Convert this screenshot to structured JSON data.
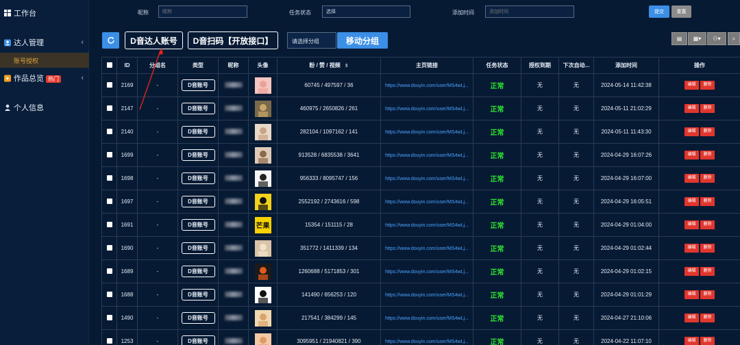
{
  "sidebar": {
    "workbench": "工作台",
    "talent_mgmt": "达人管理",
    "talent_sub": "账号授权",
    "works": "作品总览",
    "works_badge": "热门",
    "profile": "个人信息"
  },
  "filters": {
    "nickname_label": "昵称",
    "nickname_placeholder": "昵称",
    "status_label": "任务状态",
    "status_value": "选择",
    "time_label": "添加时间",
    "time_placeholder": "添加时间",
    "submit": "提交",
    "reset": "重置"
  },
  "toolbar": {
    "douyin_account": "D音达人账号",
    "douyin_scan": "D音扫码【开放接口】",
    "group_placeholder": "请选择分组",
    "move_group": "移动分组"
  },
  "table": {
    "headers": [
      "ID",
      "分组名",
      "类型",
      "昵称",
      "头像",
      "粉 / 赞 / 视频",
      "主页链接",
      "任务状态",
      "授权到期",
      "下次自动...",
      "添加时间",
      "操作"
    ],
    "edit_label": "编辑",
    "delete_label": "删除",
    "rows": [
      {
        "id": "2169",
        "group": "-",
        "type": "D音账号",
        "stats": "60745 / 497597 / 36",
        "link": "https://www.douyin.com/user/MS4wLj...",
        "status": "正常",
        "auth": "无",
        "next": "无",
        "time": "2024-05-14 11:42:38"
      },
      {
        "id": "2147",
        "group": "-",
        "type": "D音账号",
        "stats": "460975 / 2650826 / 261",
        "link": "https://www.douyin.com/user/MS4wLj...",
        "status": "正常",
        "auth": "无",
        "next": "无",
        "time": "2024-05-11 21:02:29"
      },
      {
        "id": "2140",
        "group": "-",
        "type": "D音账号",
        "stats": "282104 / 1097162 / 141",
        "link": "https://www.douyin.com/user/MS4wLj...",
        "status": "正常",
        "auth": "无",
        "next": "无",
        "time": "2024-05-11 11:43:30"
      },
      {
        "id": "1699",
        "group": "-",
        "type": "D音账号",
        "stats": "913528 / 6835538 / 3641",
        "link": "https://www.douyin.com/user/MS4wLj...",
        "status": "正常",
        "auth": "无",
        "next": "无",
        "time": "2024-04-29 16:07:26"
      },
      {
        "id": "1698",
        "group": "-",
        "type": "D音账号",
        "stats": "956333 / 8095747 / 156",
        "link": "https://www.douyin.com/user/MS4wLj...",
        "status": "正常",
        "auth": "无",
        "next": "无",
        "time": "2024-04-29 16:07:00"
      },
      {
        "id": "1697",
        "group": "-",
        "type": "D音账号",
        "stats": "2552192 / 2743616 / 598",
        "link": "https://www.douyin.com/user/MS4wLj...",
        "status": "正常",
        "auth": "无",
        "next": "无",
        "time": "2024-04-29 16:05:51"
      },
      {
        "id": "1691",
        "group": "-",
        "type": "D音账号",
        "stats": "15354 / 151115 / 28",
        "link": "https://www.douyin.com/user/MS4wLj...",
        "status": "正常",
        "auth": "无",
        "next": "无",
        "time": "2024-04-29 01:04:00"
      },
      {
        "id": "1690",
        "group": "-",
        "type": "D音账号",
        "stats": "351772 / 1411339 / 134",
        "link": "https://www.douyin.com/user/MS4wLj...",
        "status": "正常",
        "auth": "无",
        "next": "无",
        "time": "2024-04-29 01:02:44"
      },
      {
        "id": "1689",
        "group": "-",
        "type": "D音账号",
        "stats": "1260688 / 5171853 / 301",
        "link": "https://www.douyin.com/user/MS4wLj...",
        "status": "正常",
        "auth": "无",
        "next": "无",
        "time": "2024-04-29 01:02:15"
      },
      {
        "id": "1688",
        "group": "-",
        "type": "D音账号",
        "stats": "141490 / 656253 / 120",
        "link": "https://www.douyin.com/user/MS4wLj...",
        "status": "正常",
        "auth": "无",
        "next": "无",
        "time": "2024-04-29 01:01:29"
      },
      {
        "id": "1490",
        "group": "-",
        "type": "D音账号",
        "stats": "217541 / 384299 / 145",
        "link": "https://www.douyin.com/user/MS4wLj...",
        "status": "正常",
        "auth": "无",
        "next": "无",
        "time": "2024-04-27 21:10:06"
      },
      {
        "id": "1253",
        "group": "-",
        "type": "D音账号",
        "stats": "3095951 / 21940821 / 390",
        "link": "https://www.douyin.com/user/MS4wLj...",
        "status": "正常",
        "auth": "无",
        "next": "无",
        "time": "2024-04-22 11:07:10"
      }
    ]
  },
  "avatar_texts": {
    "mango": "芒果"
  },
  "colors": {
    "background": "#071a34",
    "accent": "#3b8fe6",
    "status_ok": "#2fe22f",
    "danger": "#e1362d",
    "link": "#4aa3ff",
    "active_sub": "#d9a441"
  }
}
